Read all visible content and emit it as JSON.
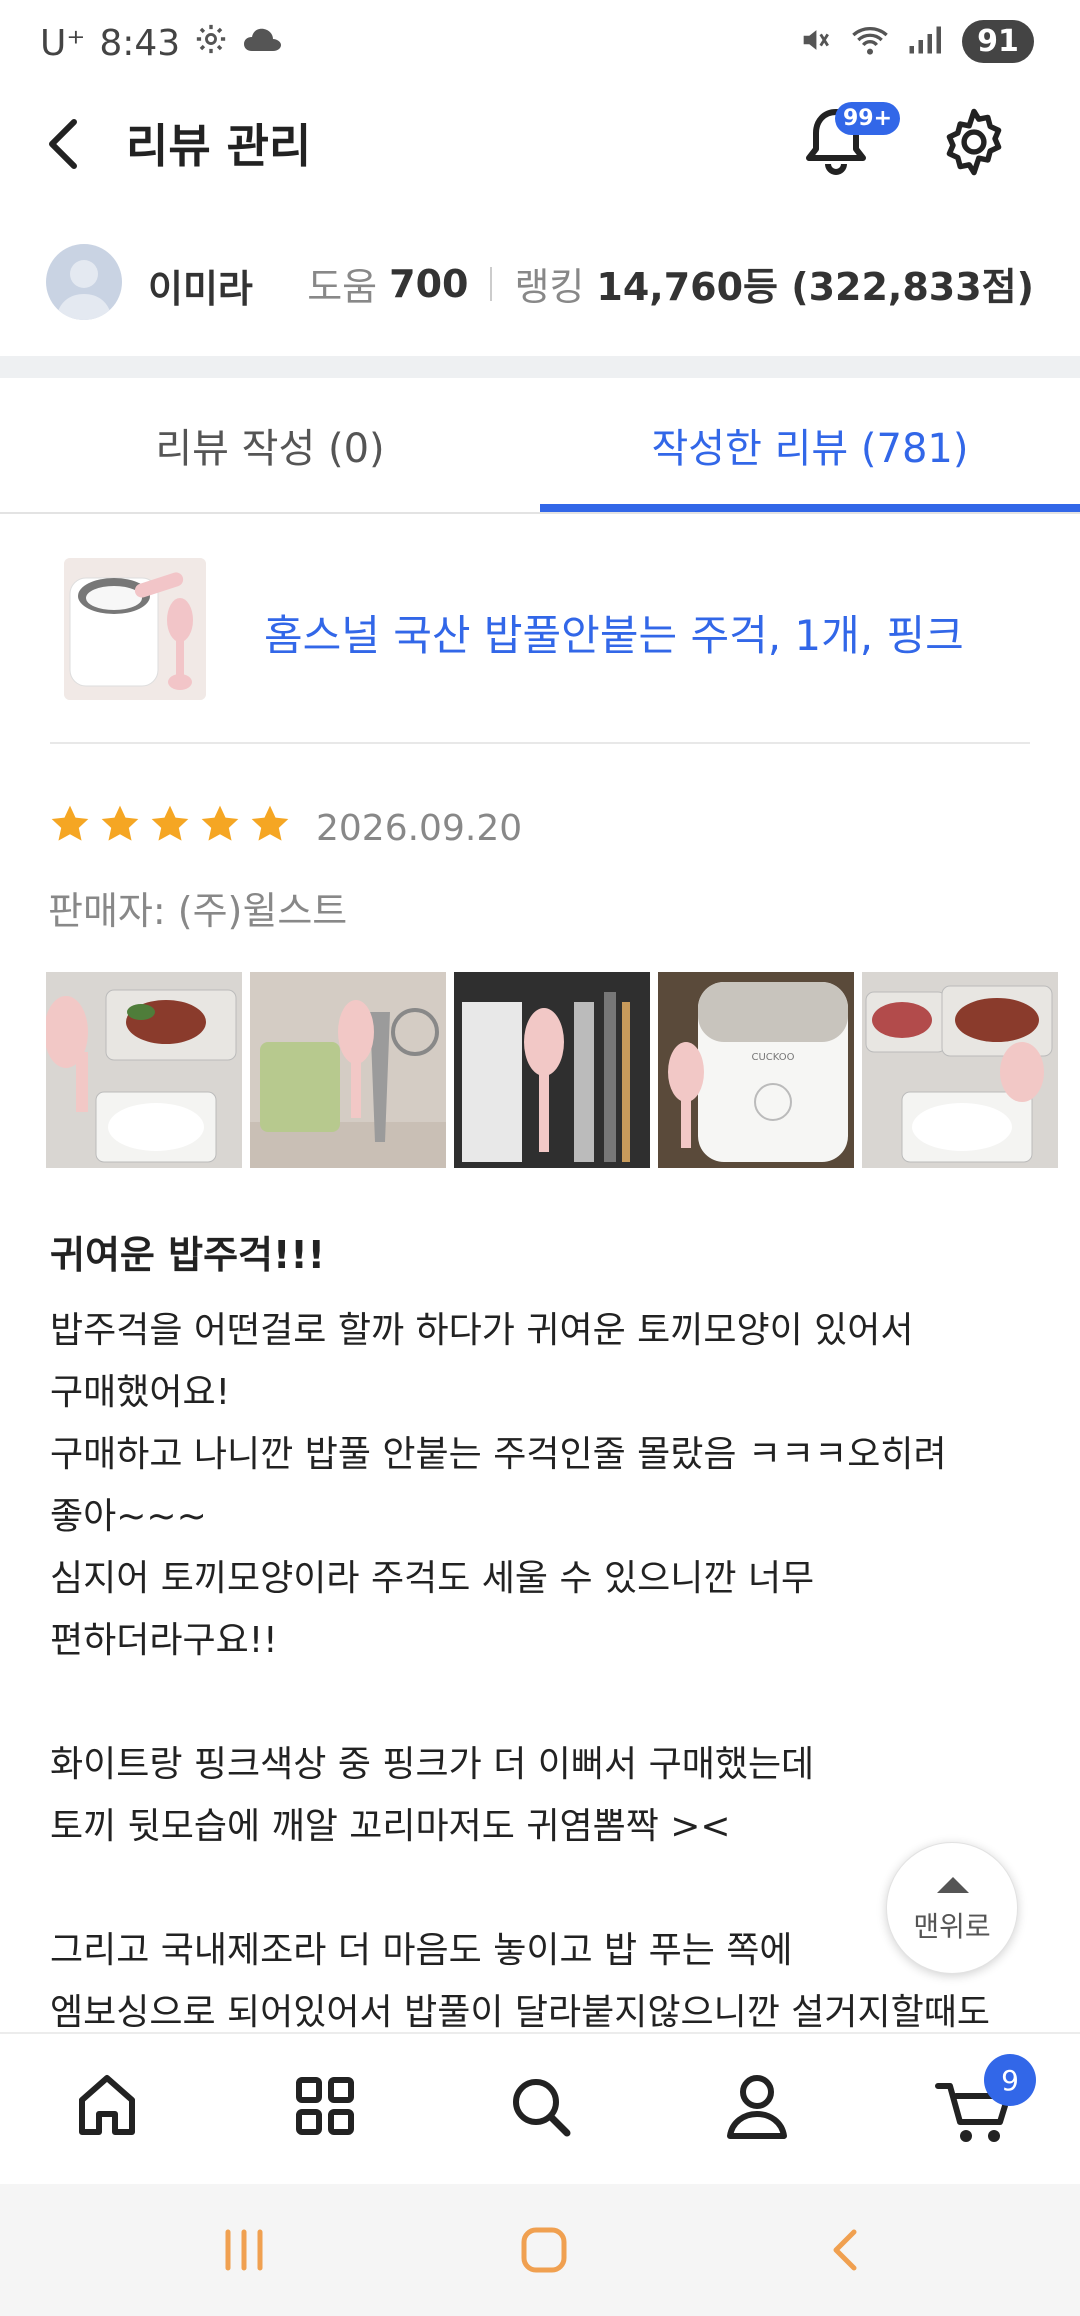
{
  "status_bar": {
    "carrier": "U⁺",
    "time": "8:43",
    "battery": "91",
    "icons": [
      "gear-icon",
      "cloud-icon",
      "mute-icon",
      "wifi-icon",
      "signal-icon"
    ]
  },
  "header": {
    "title": "리뷰 관리",
    "bell_badge": "99+"
  },
  "profile": {
    "name": "이미라",
    "help_label": "도움",
    "help_value": "700",
    "rank_label": "랭킹",
    "rank_value": "14,760등 (322,833점)"
  },
  "tabs": [
    {
      "label": "리뷰 작성 (0)",
      "active": false
    },
    {
      "label": "작성한 리뷰 (781)",
      "active": true
    }
  ],
  "product": {
    "title": "홈스널 국산 밥풀안붙는 주걱, 1개, 핑크"
  },
  "review": {
    "rating": 5,
    "date": "2026.09.20",
    "seller": "판매자: (주)윌스트",
    "title": "귀여운 밥주걱!!!",
    "body": "밥주걱을 어떤걸로 할까 하다가 귀여운 토끼모양이 있어서\n구매했어요!\n구매하고 나니깐 밥풀 안붙는 주걱인줄 몰랐음 ㅋㅋㅋ오히려\n좋아~~~\n심지어 토끼모양이라 주걱도 세울 수 있으니깐 너무\n편하더라구요!!\n\n화이트랑 핑크색상 중 핑크가 더 이뻐서 구매했는데\n토끼 뒷모습에 깨알 꼬리마저도 귀염뽐짝 ><\n\n그리고 국내제조라 더 마음도 놓이고 밥 푸는 쪽에\n엠보싱으로 되어있어서 밥풀이 달라붙지않으니깐 설거지할때도",
    "photo_brand_text": "CUCKOO"
  },
  "scroll_top": {
    "label": "맨위로"
  },
  "bottom_nav": {
    "items": [
      "home-icon",
      "grid-icon",
      "search-icon",
      "person-icon",
      "cart-icon"
    ],
    "cart_badge": "9"
  },
  "colors": {
    "accent": "#3267e8",
    "star": "#f5a623",
    "system_nav": "#f0a050"
  }
}
